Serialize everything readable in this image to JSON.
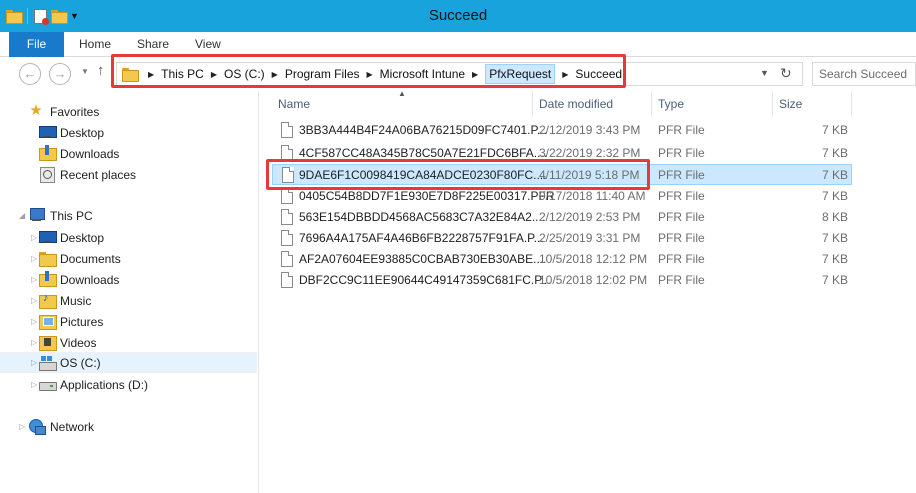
{
  "window": {
    "title": "Succeed"
  },
  "ribbon": {
    "tabs": [
      "File",
      "Home",
      "Share",
      "View"
    ]
  },
  "address": {
    "crumbs": [
      "This PC",
      "OS (C:)",
      "Program Files",
      "Microsoft Intune",
      "PfxRequest",
      "Succeed"
    ],
    "active_crumb": "PfxRequest"
  },
  "search": {
    "placeholder": "Search Succeed"
  },
  "nav": {
    "favorites": {
      "label": "Favorites",
      "items": [
        "Desktop",
        "Downloads",
        "Recent places"
      ]
    },
    "this_pc": {
      "label": "This PC",
      "items": [
        "Desktop",
        "Documents",
        "Downloads",
        "Music",
        "Pictures",
        "Videos",
        "OS (C:)",
        "Applications (D:)"
      ],
      "selected": "OS (C:)"
    },
    "network": {
      "label": "Network"
    }
  },
  "columns": [
    "Name",
    "Date modified",
    "Type",
    "Size"
  ],
  "files": [
    {
      "name": "3BB3A444B4F24A06BA76215D09FC7401.P...",
      "date": "2/12/2019 3:43 PM",
      "type": "PFR File",
      "size": "7 KB"
    },
    {
      "name": "4CF587CC48A345B78C50A7E21FDC6BFA....",
      "date": "3/22/2019 2:32 PM",
      "type": "PFR File",
      "size": "7 KB"
    },
    {
      "name": "9DAE6F1C0098419CA84ADCE0230F80FC....",
      "date": "4/11/2019 5:18 PM",
      "type": "PFR File",
      "size": "7 KB",
      "selected": true
    },
    {
      "name": "0405C54B8DD7F1E930E7D8F225E00317.PFR",
      "date": "9/17/2018 11:40 AM",
      "type": "PFR File",
      "size": "7 KB"
    },
    {
      "name": "563E154DBBDD4568AC5683C7A32E84A2....",
      "date": "2/12/2019 2:53 PM",
      "type": "PFR File",
      "size": "8 KB"
    },
    {
      "name": "7696A4A175AF4A46B6FB2228757F91FA.P...",
      "date": "2/25/2019 3:31 PM",
      "type": "PFR File",
      "size": "7 KB"
    },
    {
      "name": "AF2A07604EE93885C0CBAB730EB30ABE....",
      "date": "10/5/2018 12:12 PM",
      "type": "PFR File",
      "size": "7 KB"
    },
    {
      "name": "DBF2CC9C11EE90644C49147359C681FC.P...",
      "date": "10/5/2018 12:02 PM",
      "type": "PFR File",
      "size": "7 KB"
    }
  ],
  "colors": {
    "titlebar": "#18a3dc",
    "file_tab": "#1979ca",
    "selection": "#cce8ff",
    "highlight_box": "#e8393a"
  }
}
